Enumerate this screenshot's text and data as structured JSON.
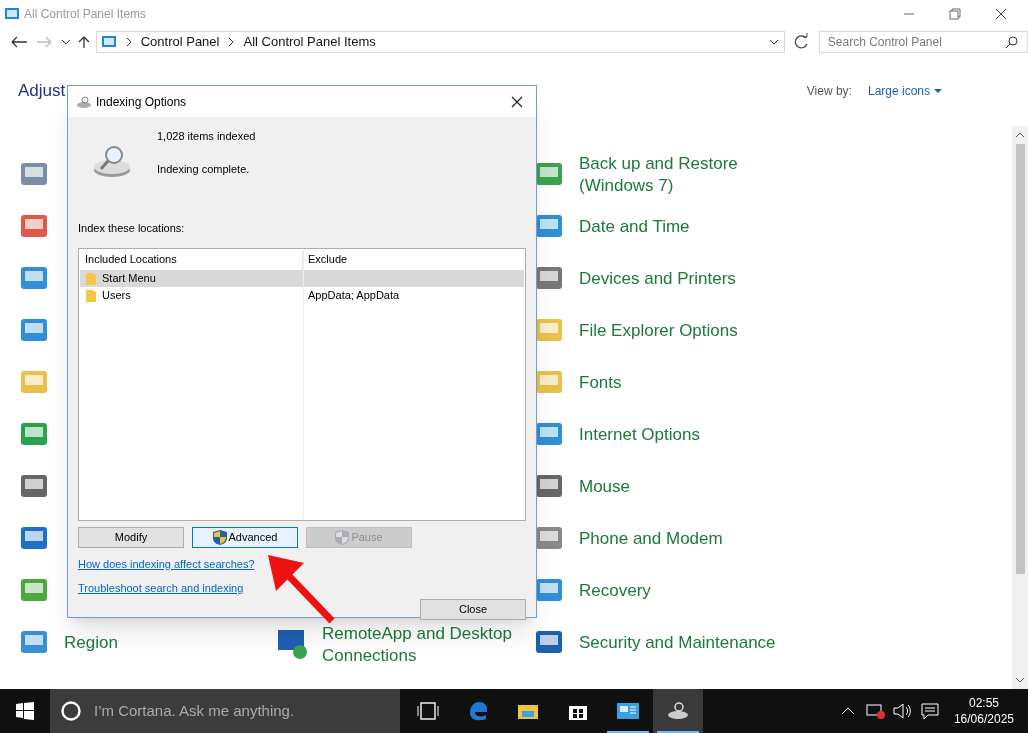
{
  "window": {
    "title": "All Control Panel Items"
  },
  "nav": {
    "breadcrumb": [
      "Control Panel",
      "All Control Panel Items"
    ],
    "search_placeholder": "Search Control Panel"
  },
  "header": {
    "title": "Adjust",
    "view_by_label": "View by:",
    "view_by_value": "Large icons"
  },
  "left_column": {
    "labels": [
      "Region"
    ]
  },
  "middle_column": {
    "labels": [
      "RemoteApp and Desktop Connections"
    ]
  },
  "right_column": {
    "items": [
      {
        "label": "Back up and Restore (Windows 7)"
      },
      {
        "label": "Date and Time"
      },
      {
        "label": "Devices and Printers"
      },
      {
        "label": "File Explorer Options"
      },
      {
        "label": "Fonts"
      },
      {
        "label": "Internet Options"
      },
      {
        "label": "Mouse"
      },
      {
        "label": "Phone and Modem"
      },
      {
        "label": "Recovery"
      },
      {
        "label": "Security and Maintenance"
      }
    ]
  },
  "dialog": {
    "title": "Indexing Options",
    "count": "1,028 items indexed",
    "status": "Indexing complete.",
    "list_label": "Index these locations:",
    "columns": [
      "Included Locations",
      "Exclude"
    ],
    "rows": [
      {
        "location": "Start Menu",
        "exclude": "",
        "selected": true
      },
      {
        "location": "Users",
        "exclude": "AppData; AppData",
        "selected": false
      }
    ],
    "buttons": [
      {
        "label": "Modify",
        "shield": false,
        "disabled": false,
        "hovered": false
      },
      {
        "label": "Advanced",
        "shield": true,
        "disabled": false,
        "hovered": true
      },
      {
        "label": "Pause",
        "shield": true,
        "disabled": true,
        "hovered": false
      }
    ],
    "links": [
      "How does indexing affect searches?",
      "Troubleshoot search and indexing"
    ],
    "close_button": "Close"
  },
  "taskbar": {
    "search_placeholder": "I’m Cortana. Ask me anything.",
    "apps": [
      {
        "kind": "task-view",
        "running": false,
        "active": false
      },
      {
        "kind": "edge",
        "running": false,
        "active": false
      },
      {
        "kind": "explorer",
        "running": false,
        "active": false
      },
      {
        "kind": "store",
        "running": false,
        "active": false
      },
      {
        "kind": "control-panel",
        "running": true,
        "active": false
      },
      {
        "kind": "indexing",
        "running": true,
        "active": true
      }
    ],
    "time": "02:55",
    "date": "16/06/2025"
  }
}
